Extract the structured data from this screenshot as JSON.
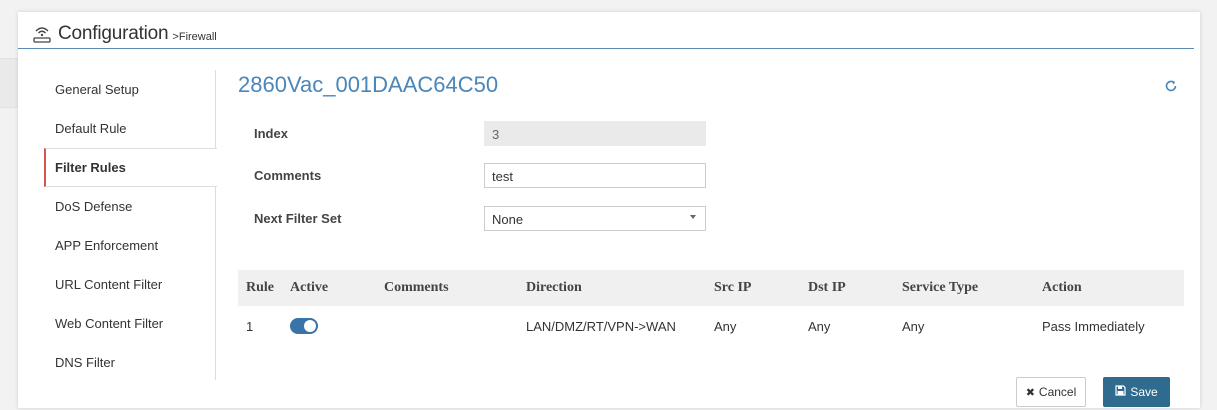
{
  "header": {
    "title": "Configuration",
    "breadcrumb": ">Firewall"
  },
  "sidebar": {
    "items": [
      {
        "label": "General Setup",
        "active": false
      },
      {
        "label": "Default Rule",
        "active": false
      },
      {
        "label": "Filter Rules",
        "active": true
      },
      {
        "label": "DoS Defense",
        "active": false
      },
      {
        "label": "APP Enforcement",
        "active": false
      },
      {
        "label": "URL Content Filter",
        "active": false
      },
      {
        "label": "Web Content Filter",
        "active": false
      },
      {
        "label": "DNS Filter",
        "active": false
      }
    ]
  },
  "device": {
    "name": "2860Vac_001DAAC64C50"
  },
  "form": {
    "index_label": "Index",
    "index_value": "3",
    "comments_label": "Comments",
    "comments_value": "test",
    "next_filter_label": "Next Filter Set",
    "next_filter_value": "None"
  },
  "table": {
    "headers": [
      "Rule",
      "Active",
      "Comments",
      "Direction",
      "Src IP",
      "Dst IP",
      "Service Type",
      "Action"
    ],
    "rows": [
      {
        "rule": "1",
        "active": true,
        "comments": "",
        "direction": "LAN/DMZ/RT/VPN->WAN",
        "src_ip": "Any",
        "dst_ip": "Any",
        "service_type": "Any",
        "action": "Pass Immediately"
      }
    ]
  },
  "buttons": {
    "cancel": "Cancel",
    "save": "Save"
  },
  "colors": {
    "accent": "#4a86b8",
    "save_button": "#2f6b8e",
    "toggle_on": "#3a73a8",
    "active_marker": "#d9534f"
  }
}
